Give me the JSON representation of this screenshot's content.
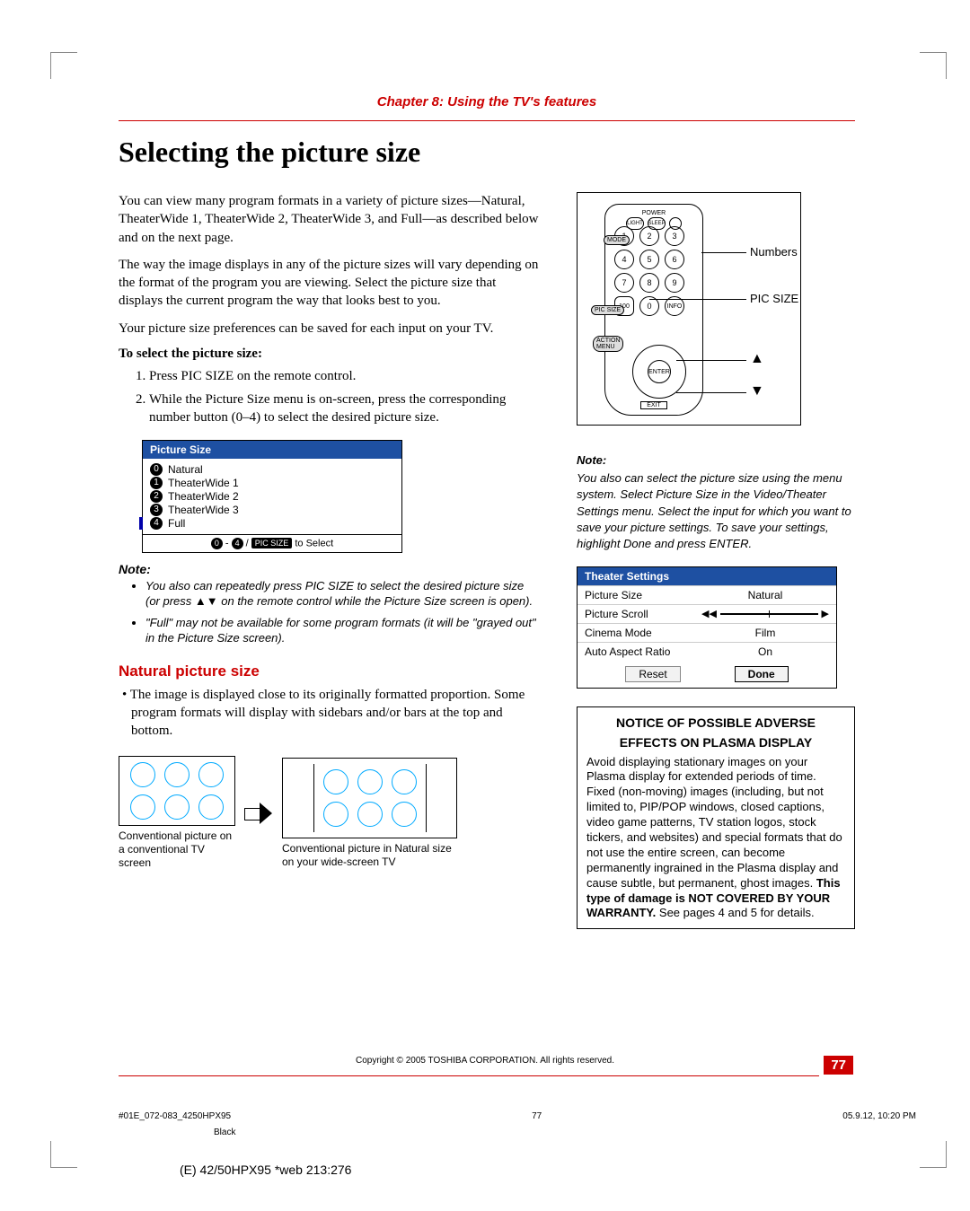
{
  "chapter_header": "Chapter 8: Using the TV's features",
  "title": "Selecting the picture size",
  "intro_p1": "You can view many program formats in a variety of picture sizes—Natural, TheaterWide 1, TheaterWide 2, TheaterWide 3, and Full—as described below and on the next page.",
  "intro_p2": "The way the image displays in any of the picture sizes will vary depending on the format of the program you are viewing. Select the picture size that displays the current program the way that looks best to you.",
  "intro_p3": "Your picture size preferences can be saved for each input on your TV.",
  "to_select_hd": "To select the picture size:",
  "steps": [
    "Press PIC SIZE on the remote control.",
    "While the Picture Size menu is on-screen, press the corresponding number button (0–4) to select the desired picture size."
  ],
  "osd1": {
    "header": "Picture Size",
    "items": [
      {
        "n": "0",
        "label": "Natural"
      },
      {
        "n": "1",
        "label": "TheaterWide 1"
      },
      {
        "n": "2",
        "label": "TheaterWide 2"
      },
      {
        "n": "3",
        "label": "TheaterWide 3"
      },
      {
        "n": "4",
        "label": "Full"
      }
    ],
    "footer_prefix_a": "0",
    "footer_dash": " - ",
    "footer_prefix_b": "4",
    "footer_slash": " / ",
    "footer_pill": "PIC SIZE",
    "footer_suffix": " to Select"
  },
  "note_label": "Note:",
  "notes_left": [
    "You also can repeatedly press PIC SIZE to select the desired picture size (or press ▲▼ on the remote control while the Picture Size screen is open).",
    "\"Full\" may not be available for some program formats (it will be \"grayed out\" in the Picture Size screen)."
  ],
  "natural_hd": "Natural picture size",
  "natural_bullet": "• The image is displayed close to its originally formatted proportion. Some program formats will display with sidebars and/or bars at the top and bottom.",
  "fig_caption_left": "Conventional picture on a conventional TV screen",
  "fig_caption_right": "Conventional picture in Natural size on your wide-screen TV",
  "remote_labels": {
    "numbers": "Numbers",
    "picsize": "PIC SIZE",
    "up": "▲",
    "down": "▼",
    "enter": "ENTER",
    "mode": "MODE",
    "picsize_pill": "PIC SIZE",
    "action": "ACTION\nMENU",
    "info": "INFO",
    "power": "POWER",
    "light": "LIGHT",
    "sleep": "SLEEP",
    "exit": "EXIT"
  },
  "right_note_hd": "Note:",
  "right_note_body": "You also can select the picture size using the menu system. Select Picture Size in the Video/Theater Settings menu. Select the input for which you want to save your picture settings. To save your settings, highlight Done and press ENTER.",
  "osd2": {
    "header": "Theater Settings",
    "rows": [
      {
        "l": "Picture Size",
        "r": "Natural"
      },
      {
        "l": "Picture Scroll",
        "slider": true
      },
      {
        "l": "Cinema Mode",
        "r": "Film"
      },
      {
        "l": "Auto Aspect Ratio",
        "r": "On"
      }
    ],
    "reset": "Reset",
    "done": "Done"
  },
  "notice": {
    "hd1": "NOTICE OF POSSIBLE ADVERSE",
    "hd2": "EFFECTS ON PLASMA DISPLAY",
    "body_a": "Avoid displaying stationary images on your Plasma display for extended periods of time. Fixed (non-moving) images (including, but not limited to, PIP/POP windows, closed captions, video game patterns, TV station logos, stock tickers, and websites) and special formats that do not use the entire screen, can become permanently ingrained in the Plasma display and cause subtle, but permanent, ghost images. ",
    "body_bold": "This type of damage is NOT COVERED BY YOUR WARRANTY.",
    "body_b": " See pages 4 and 5 for details."
  },
  "copyright": "Copyright © 2005 TOSHIBA CORPORATION. All rights reserved.",
  "page_number": "77",
  "preflight": {
    "file": "#01E_072-083_4250HPX95",
    "page": "77",
    "timestamp": "05.9.12, 10:20 PM",
    "color": "Black"
  },
  "bookline": "(E) 42/50HPX95 *web 213:276"
}
